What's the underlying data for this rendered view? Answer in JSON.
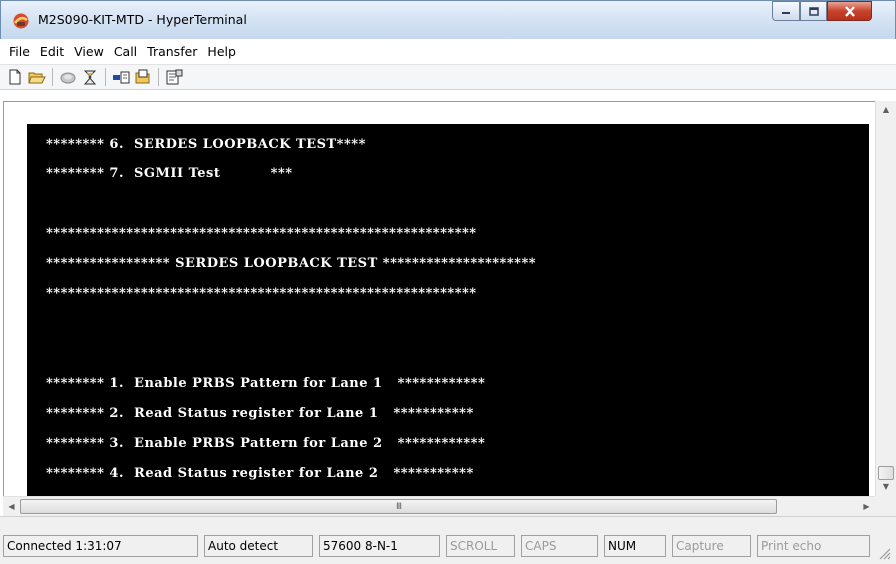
{
  "window": {
    "title": "M2S090-KIT-MTD - HyperTerminal",
    "icon": "hyperterminal-phone-icon"
  },
  "controls": {
    "minimize_icon": "minimize-icon",
    "maximize_icon": "maximize-icon",
    "close_icon": "close-icon"
  },
  "menu": [
    {
      "label": "File"
    },
    {
      "label": "Edit"
    },
    {
      "label": "View"
    },
    {
      "label": "Call"
    },
    {
      "label": "Transfer"
    },
    {
      "label": "Help"
    }
  ],
  "toolbar": [
    {
      "icon": "new-icon"
    },
    {
      "icon": "open-icon"
    },
    {
      "icon": "disconnect-icon"
    },
    {
      "icon": "properties-call-icon"
    },
    {
      "icon": "send-icon"
    },
    {
      "icon": "receive-icon"
    },
    {
      "icon": "properties-icon"
    }
  ],
  "terminal": {
    "background": "#000000",
    "foreground": "#ffffff",
    "lines": [
      "******** 6.  SERDES LOOPBACK TEST****",
      "******** 7.  SGMII Test          ***",
      "",
      "***********************************************************",
      "***************** SERDES LOOPBACK TEST *********************",
      "***********************************************************",
      "",
      "",
      "******** 1.  Enable PRBS Pattern for Lane 1   ************",
      "******** 2.  Read Status register for Lane 1   ***********",
      "******** 3.  Enable PRBS Pattern for Lane 2   ************",
      "******** 4.  Read Status register for Lane 2   ***********"
    ]
  },
  "hscroll": {
    "thumb_grip": "III"
  },
  "status": {
    "connected": "Connected 1:31:07",
    "detect": "Auto detect",
    "settings": "57600 8-N-1",
    "scroll": "SCROLL",
    "caps": "CAPS",
    "num": "NUM",
    "capture": "Capture",
    "print_echo": "Print echo"
  }
}
